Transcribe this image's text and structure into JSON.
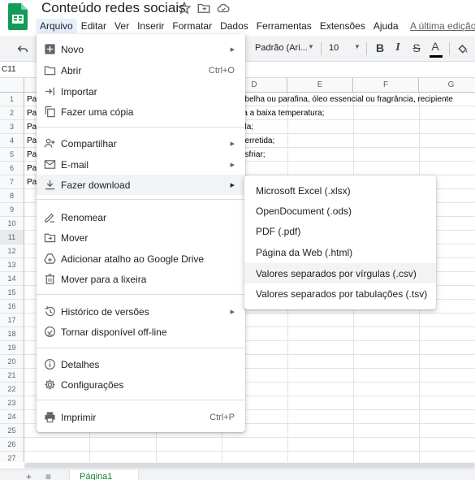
{
  "doc": {
    "title": "Conteúdo redes sociais",
    "last_edit": "A última edição"
  },
  "menubar": {
    "items": [
      "Arquivo",
      "Editar",
      "Ver",
      "Inserir",
      "Formatar",
      "Dados",
      "Ferramentas",
      "Extensões",
      "Ajuda"
    ],
    "active": "Arquivo"
  },
  "toolbar": {
    "font": "Padrão (Ari...",
    "font_size": "10",
    "bold": "B",
    "italic": "I",
    "strike": "S",
    "text_color": "A"
  },
  "formula_bar": {
    "cell_ref": "C11"
  },
  "grid": {
    "columns": [
      "D",
      "E",
      "F",
      "G"
    ],
    "rows": [
      "1",
      "2",
      "3",
      "4",
      "5",
      "6",
      "7",
      "8",
      "9",
      "10",
      "11",
      "12",
      "13",
      "14",
      "15",
      "16",
      "17",
      "18",
      "19",
      "20",
      "21",
      "22",
      "23",
      "24",
      "25",
      "26",
      "27"
    ],
    "selected_row": "11",
    "col_a_text": [
      "Pa",
      "Pa",
      "Pa",
      "Pa",
      "Pa",
      "Pa",
      "Pa"
    ],
    "col_d_text": [
      "abelha ou parafina, óleo essencial ou fragrância, recipiente",
      "-a a baixa temperatura;",
      "ela;",
      "derretida;",
      "esfriar;"
    ]
  },
  "file_menu": {
    "items": [
      {
        "label": "Novo",
        "icon": "new-sheet-icon",
        "submenu": true
      },
      {
        "label": "Abrir",
        "icon": "folder-icon",
        "shortcut": "Ctrl+O"
      },
      {
        "label": "Importar",
        "icon": "import-icon"
      },
      {
        "label": "Fazer uma cópia",
        "icon": "copy-icon"
      },
      {
        "label": "Compartilhar",
        "icon": "share-person-icon",
        "submenu": true
      },
      {
        "label": "E-mail",
        "icon": "email-icon",
        "submenu": true
      },
      {
        "label": "Fazer download",
        "icon": "download-icon",
        "submenu": true,
        "highlighted": true
      },
      {
        "label": "Renomear",
        "icon": "rename-icon"
      },
      {
        "label": "Mover",
        "icon": "move-folder-icon"
      },
      {
        "label": "Adicionar atalho ao Google Drive",
        "icon": "drive-shortcut-icon"
      },
      {
        "label": "Mover para a lixeira",
        "icon": "trash-icon"
      },
      {
        "label": "Histórico de versões",
        "icon": "history-icon",
        "submenu": true
      },
      {
        "label": "Tornar disponível off-line",
        "icon": "offline-icon"
      },
      {
        "label": "Detalhes",
        "icon": "info-icon"
      },
      {
        "label": "Configurações",
        "icon": "gear-icon"
      },
      {
        "label": "Imprimir",
        "icon": "print-icon",
        "shortcut": "Ctrl+P"
      }
    ]
  },
  "download_menu": {
    "items": [
      "Microsoft Excel (.xlsx)",
      "OpenDocument (.ods)",
      "PDF (.pdf)",
      "Página da Web (.html)",
      "Valores separados por vírgulas (.csv)",
      "Valores separados por tabulações (.tsv)"
    ],
    "highlighted_index": 4
  },
  "sheet_tab": {
    "label": "Página1"
  },
  "colors": {
    "sheets_green": "#188038",
    "menu_highlight": "#f1f3f4",
    "active_menu_bg": "#e8f0fe"
  }
}
